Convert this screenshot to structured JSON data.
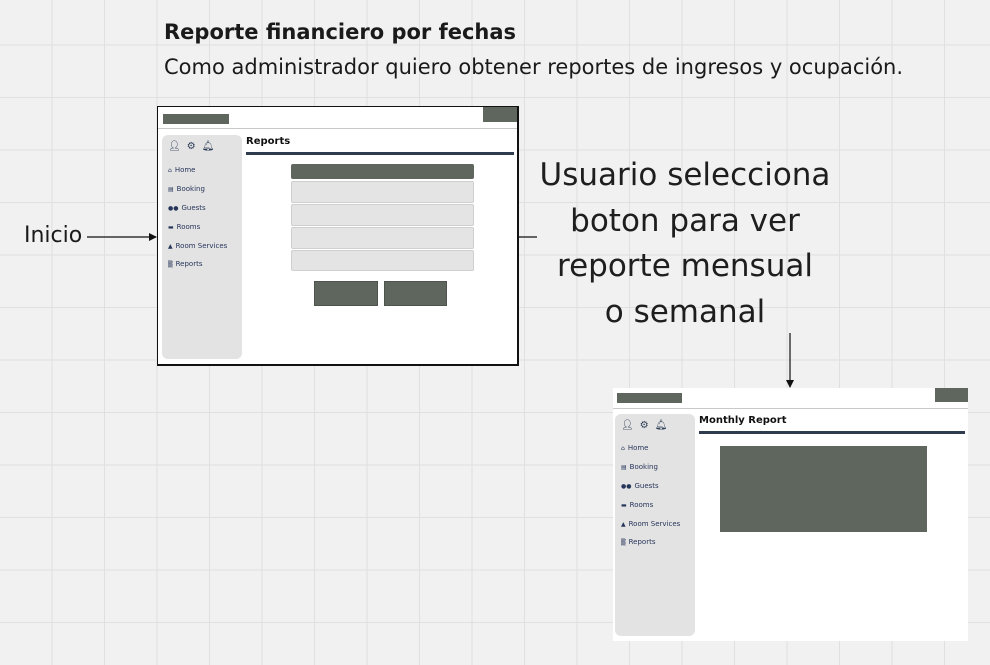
{
  "heading": {
    "title": "Reporte financiero por fechas",
    "description": "Como administrador quiero obtener reportes de ingresos y ocupación."
  },
  "annotations": {
    "start_label": "Inicio",
    "note_lines": [
      "Usuario selecciona",
      "boton para ver",
      "reporte mensual",
      "o semanal"
    ]
  },
  "screen_reports": {
    "title": "Reports"
  },
  "screen_monthly": {
    "title": "Monthly Report"
  },
  "sidebar": {
    "top_icons": [
      "user-icon",
      "gear-icon",
      "bell-icon"
    ],
    "items": [
      {
        "label": "Home",
        "icon": "home-icon"
      },
      {
        "label": "Booking",
        "icon": "calendar-icon"
      },
      {
        "label": "Guests",
        "icon": "people-icon"
      },
      {
        "label": "Rooms",
        "icon": "bed-icon"
      },
      {
        "label": "Room Services",
        "icon": "room-service-icon"
      },
      {
        "label": "Reports",
        "icon": "chart-icon"
      }
    ]
  },
  "colors": {
    "placeholder_dark": "#5f665e",
    "accent_rule": "#2f3b4f",
    "sidebar_bg": "#e3e3e3",
    "canvas_bg": "#f1f1f1"
  }
}
